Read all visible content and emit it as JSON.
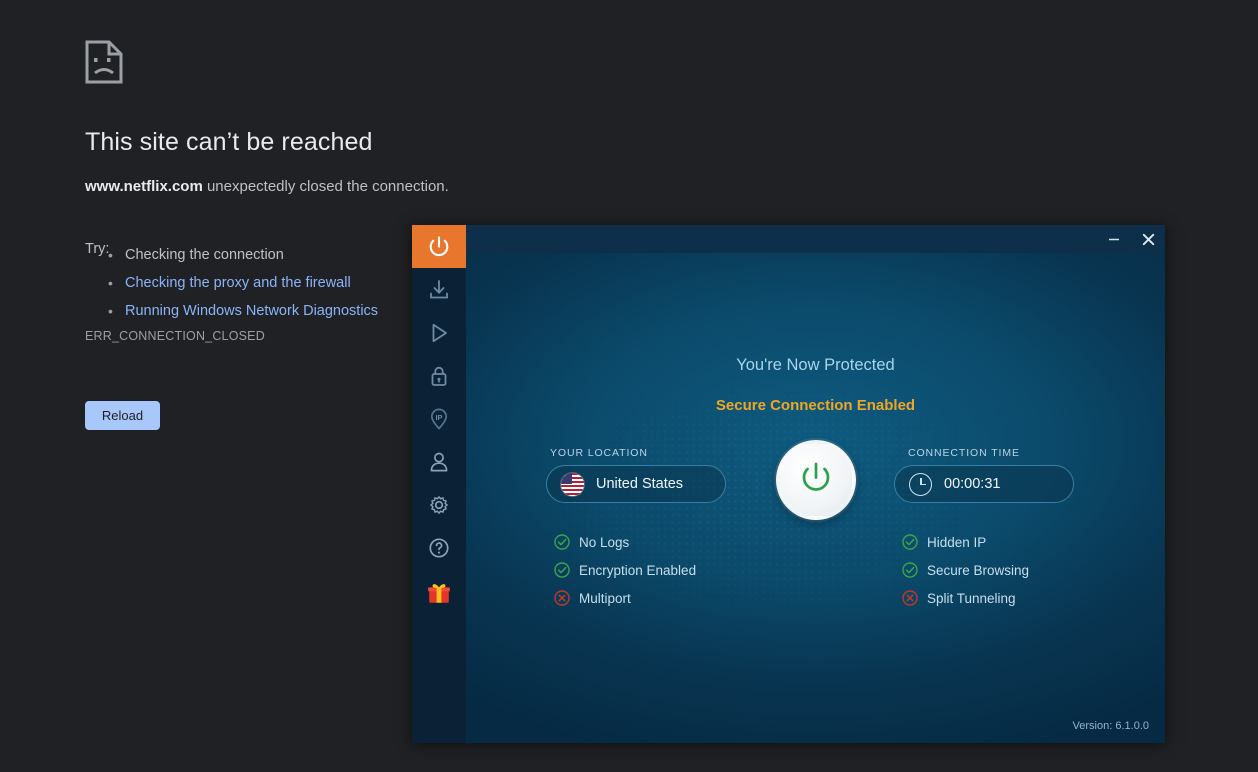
{
  "error_page": {
    "icon": "sad-page-icon",
    "title": "This site can’t be reached",
    "subtitle_host": "www.netflix.com",
    "subtitle_rest": " unexpectedly closed the connection.",
    "try_label": "Try:",
    "suggestions": [
      {
        "text": "Checking the connection",
        "is_link": false
      },
      {
        "text": "Checking the proxy and the firewall",
        "is_link": true
      },
      {
        "text": "Running Windows Network Diagnostics",
        "is_link": true
      }
    ],
    "error_code": "ERR_CONNECTION_CLOSED",
    "reload_label": "Reload",
    "colors": {
      "background": "#202124",
      "title": "#e8eaed",
      "body_text": "#bdc1c6",
      "link": "#8ab4f8",
      "button": "#a8c7fa"
    }
  },
  "vpn_app": {
    "titlebar": {
      "minimize_label": "—",
      "close_label": "✕"
    },
    "sidebar": [
      {
        "name": "power",
        "label": "Power",
        "active": true
      },
      {
        "name": "download",
        "label": "Download",
        "active": false
      },
      {
        "name": "play",
        "label": "Streaming",
        "active": false
      },
      {
        "name": "lock",
        "label": "Security",
        "active": false
      },
      {
        "name": "ip",
        "label": "IP",
        "active": false
      },
      {
        "name": "user",
        "label": "Account",
        "active": false
      },
      {
        "name": "gear",
        "label": "Settings",
        "active": false
      },
      {
        "name": "help",
        "label": "Help",
        "active": false
      },
      {
        "name": "gift",
        "label": "Offers",
        "active": false
      }
    ],
    "status": {
      "headline": "You're Now Protected",
      "subline": "Secure Connection Enabled",
      "headline_color": "#a8d4ec",
      "subline_color": "#f0a623"
    },
    "location": {
      "label": "YOUR LOCATION",
      "value": "United States",
      "flag": "us-flag-icon"
    },
    "connection_time": {
      "label": "CONNECTION TIME",
      "value": "00:00:31",
      "icon": "clock-icon"
    },
    "power_button": {
      "name": "power-toggle",
      "state": "on",
      "icon_color": "#28a745"
    },
    "features_left": [
      {
        "label": "No Logs",
        "status": "ok"
      },
      {
        "label": "Encryption Enabled",
        "status": "ok"
      },
      {
        "label": "Multiport",
        "status": "off"
      }
    ],
    "features_right": [
      {
        "label": "Hidden IP",
        "status": "ok"
      },
      {
        "label": "Secure Browsing",
        "status": "ok"
      },
      {
        "label": "Split Tunneling",
        "status": "off"
      }
    ],
    "version": "Version: 6.1.0.0",
    "colors": {
      "sidebar": "#0b2236",
      "titlebar": "#0d2f49",
      "body": "#0b4a6b",
      "accent_orange": "#e8762c",
      "ok_green": "#3fa24a",
      "off_red": "#c0392b"
    }
  }
}
